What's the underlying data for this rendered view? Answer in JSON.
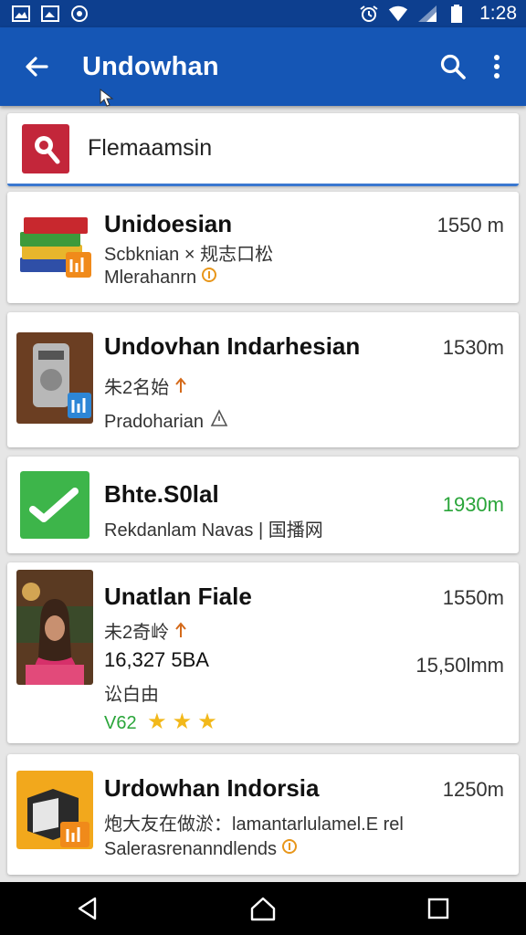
{
  "status_bar": {
    "time": "1:28",
    "left_icons": [
      "gallery-notification-icon",
      "image-notification-icon",
      "app-notification-icon"
    ],
    "right_icons": [
      "alarm-icon",
      "wifi-icon",
      "signal-icon",
      "battery-icon"
    ]
  },
  "app_bar": {
    "title": "Undowhan",
    "color": "#1556b5",
    "status_color": "#0d3f8f"
  },
  "search": {
    "value": "Flemaamsin"
  },
  "items": [
    {
      "title": "Unidoesian",
      "meta": "1550 m",
      "line1": "Scbknian × 规志口松",
      "line2": "Mlerahanrn",
      "thumb_icon": "books-icon"
    },
    {
      "title": "Undovhan Indarhesian",
      "meta": "1530m",
      "line1": "朱2名始",
      "line2": "Pradoharian",
      "thumb_icon": "device-icon"
    },
    {
      "title": "Bhte.S0lal",
      "meta": "1930m",
      "line1": "Rekdanlam Navas | 国播网",
      "thumb_icon": "green-check-icon"
    },
    {
      "title": "Unatlan Fiale",
      "meta": "1550m",
      "line1": "未2奇岭",
      "line2": "16,327 5BA",
      "line2_meta": "15,50lmm",
      "line3": "讼白由",
      "rating_label": "V62",
      "stars": 3,
      "thumb_icon": "person-photo"
    },
    {
      "title": "Urdowhan Indorsia",
      "meta": "1250m",
      "line1": "炮大友在做淤：lamantarlulamel.E rel",
      "line2": "Salerasrenanndlends",
      "thumb_icon": "box-icon"
    }
  ],
  "nav": [
    "back-nav-icon",
    "home-nav-icon",
    "recents-nav-icon"
  ]
}
